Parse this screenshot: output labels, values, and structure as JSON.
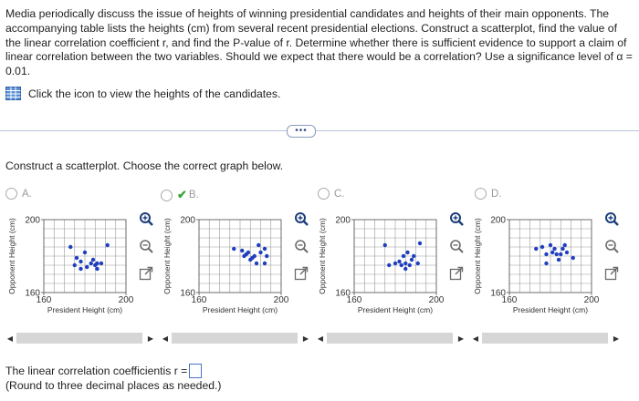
{
  "problem": {
    "text": "Media periodically discuss the issue of heights of winning presidential candidates and heights of their main opponents. The accompanying table lists the heights (cm) from several recent presidential elections. Construct a scatterplot, find the value of the linear correlation coefficient r, and find the P-value of r. Determine whether there is sufficient evidence to support a claim of linear correlation between the two variables. Should we expect that there would be a correlation? Use a significance level of α = 0.01."
  },
  "table_link": {
    "label": "Click the icon to view the heights of the candidates.",
    "icon": "table-icon"
  },
  "expand_button": {
    "label": "•••"
  },
  "instruction": "Construct a scatterplot. Choose the correct graph below.",
  "options": [
    {
      "letter": "A.",
      "selected": false
    },
    {
      "letter": "B.",
      "selected": true
    },
    {
      "letter": "C.",
      "selected": false
    },
    {
      "letter": "D.",
      "selected": false
    }
  ],
  "chart_data": [
    {
      "type": "scatter",
      "option": "A",
      "xlabel": "President Height (cm)",
      "ylabel": "Opponent Height (cm)",
      "xlim": [
        160,
        200
      ],
      "ylim": [
        160,
        200
      ],
      "xticks": [
        "160",
        "200"
      ],
      "yticks": [
        "160",
        "200"
      ],
      "grid": true,
      "points": [
        [
          173,
          185
        ],
        [
          176,
          179
        ],
        [
          178,
          177
        ],
        [
          180,
          182
        ],
        [
          181,
          174
        ],
        [
          183,
          176
        ],
        [
          184,
          178
        ],
        [
          185,
          175
        ],
        [
          186,
          176
        ],
        [
          186,
          173
        ],
        [
          178,
          173
        ],
        [
          188,
          176
        ],
        [
          191,
          186
        ],
        [
          175,
          175
        ]
      ]
    },
    {
      "type": "scatter",
      "option": "B",
      "xlabel": "President Height (cm)",
      "ylabel": "Opponent Height (cm)",
      "xlim": [
        160,
        200
      ],
      "ylim": [
        160,
        200
      ],
      "xticks": [
        "160",
        "200"
      ],
      "yticks": [
        "160",
        "200"
      ],
      "grid": true,
      "points": [
        [
          177,
          184
        ],
        [
          181,
          183
        ],
        [
          182,
          180
        ],
        [
          183,
          181
        ],
        [
          184,
          182
        ],
        [
          185,
          178
        ],
        [
          186,
          179
        ],
        [
          187,
          180
        ],
        [
          188,
          176
        ],
        [
          189,
          186
        ],
        [
          190,
          182
        ],
        [
          192,
          184
        ],
        [
          193,
          180
        ],
        [
          192,
          176
        ]
      ]
    },
    {
      "type": "scatter",
      "option": "C",
      "xlabel": "President Height (cm)",
      "ylabel": "Opponent Height (cm)",
      "xlim": [
        160,
        200
      ],
      "ylim": [
        160,
        200
      ],
      "xticks": [
        "160",
        "200"
      ],
      "yticks": [
        "160",
        "200"
      ],
      "grid": true,
      "points": [
        [
          175,
          186
        ],
        [
          177,
          175
        ],
        [
          180,
          176
        ],
        [
          182,
          177
        ],
        [
          183,
          175
        ],
        [
          184,
          180
        ],
        [
          185,
          176
        ],
        [
          186,
          182
        ],
        [
          187,
          175
        ],
        [
          188,
          178
        ],
        [
          189,
          180
        ],
        [
          191,
          176
        ],
        [
          192,
          187
        ],
        [
          185,
          173
        ]
      ]
    },
    {
      "type": "scatter",
      "option": "D",
      "xlabel": "President Height (cm)",
      "ylabel": "Opponent Height (cm)",
      "xlim": [
        160,
        200
      ],
      "ylim": [
        160,
        200
      ],
      "xticks": [
        "160",
        "200"
      ],
      "yticks": [
        "160",
        "200"
      ],
      "grid": true,
      "points": [
        [
          173,
          184
        ],
        [
          176,
          185
        ],
        [
          178,
          181
        ],
        [
          180,
          186
        ],
        [
          181,
          182
        ],
        [
          182,
          184
        ],
        [
          183,
          181
        ],
        [
          184,
          178
        ],
        [
          185,
          181
        ],
        [
          186,
          184
        ],
        [
          187,
          186
        ],
        [
          188,
          182
        ],
        [
          191,
          179
        ],
        [
          178,
          176
        ]
      ]
    }
  ],
  "answer": {
    "prefix": "The linear correlation coefficientis r =",
    "note": "(Round to three decimal places as needed.)"
  },
  "colors": {
    "point": "#1f3fbf",
    "grid": "#9a9a9a",
    "accent": "#2f6bd1",
    "check": "#3aa53a"
  }
}
